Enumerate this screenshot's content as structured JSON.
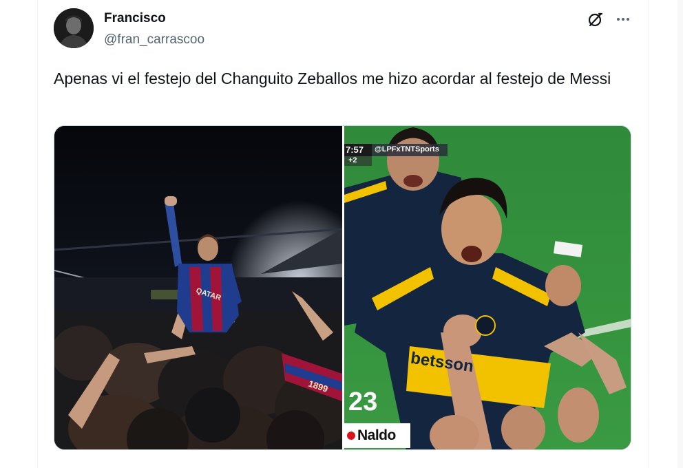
{
  "tweet": {
    "author_name": "Francisco",
    "author_handle": "@fran_carrascoo",
    "text": "Apenas vi el festejo del Changuito Zeballos me hizo acordar al festejo de Messi",
    "actions": {
      "grok_icon": "grok-icon",
      "more_icon": "more-icon"
    }
  },
  "media": {
    "right_image": {
      "scoreboard_time": "7:57",
      "scoreboard_extra": "+2",
      "broadcaster_tag": "@LPFxTNTSports",
      "sponsor_text": "betsson",
      "jersey_number": "23",
      "ad_label": "Naldo"
    },
    "left_image": {
      "shirt_text": "QATAR",
      "shirt_number": "1899"
    }
  },
  "colors": {
    "text_primary": "#0f1419",
    "text_secondary": "#536471",
    "border": "#cfd9de",
    "boca_blue": "#14253f",
    "boca_gold": "#f2c200",
    "barca_blue": "#1f3c8f",
    "barca_red": "#a1143a"
  }
}
